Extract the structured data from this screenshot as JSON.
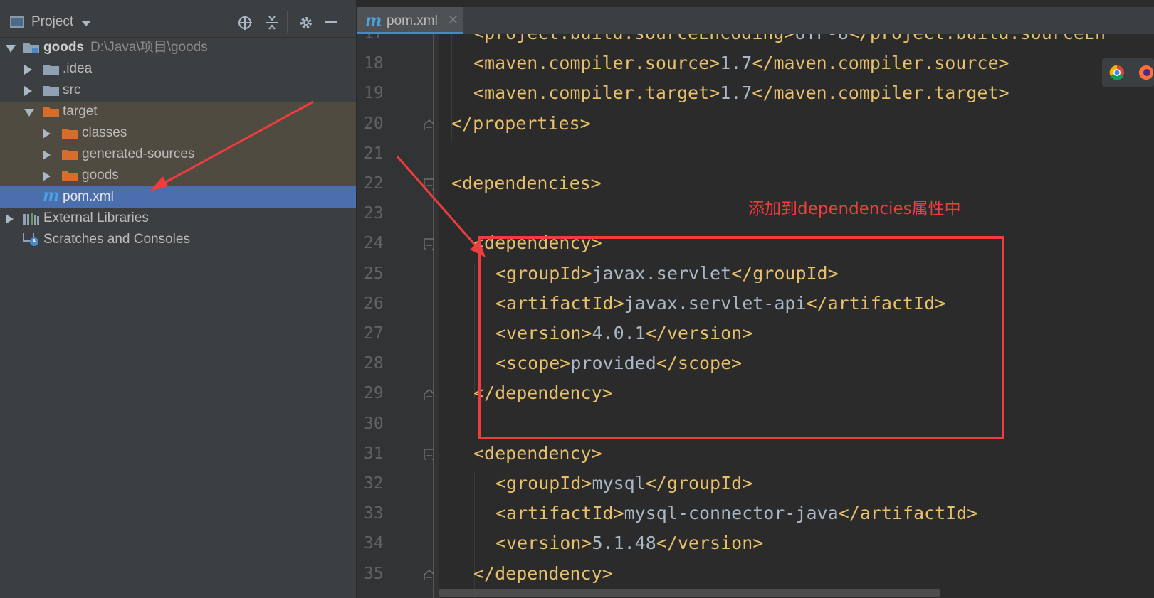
{
  "project_panel": {
    "title": "Project",
    "tree": [
      {
        "label": "goods",
        "path": "D:\\Java\\项目\\goods"
      },
      {
        "label": ".idea"
      },
      {
        "label": "src"
      },
      {
        "label": "target"
      },
      {
        "label": "classes"
      },
      {
        "label": "generated-sources"
      },
      {
        "label": "goods"
      },
      {
        "label": "pom.xml"
      },
      {
        "label": "External Libraries"
      },
      {
        "label": "Scratches and Consoles"
      }
    ]
  },
  "editor": {
    "tab": {
      "name": "pom.xml"
    },
    "line_numbers": [
      "17",
      "18",
      "19",
      "20",
      "21",
      "22",
      "23",
      "24",
      "25",
      "26",
      "27",
      "28",
      "29",
      "30",
      "31",
      "32",
      "33",
      "34",
      "35"
    ],
    "lines": [
      {
        "open": "<project.build.sourceEncoding>",
        "text": "UTF-8",
        "close": "</project.build.sourceEn"
      },
      {
        "open": "<maven.compiler.source>",
        "text": "1.7",
        "close": "</maven.compiler.source>"
      },
      {
        "open": "<maven.compiler.target>",
        "text": "1.7",
        "close": "</maven.compiler.target>"
      },
      {
        "open": "</properties>",
        "text": "",
        "close": ""
      },
      {
        "open": "",
        "text": "",
        "close": ""
      },
      {
        "open": "<dependencies>",
        "text": "",
        "close": ""
      },
      {
        "open": "",
        "text": "",
        "close": ""
      },
      {
        "open": "<dependency>",
        "text": "",
        "close": ""
      },
      {
        "open": "<groupId>",
        "text": "javax.servlet",
        "close": "</groupId>"
      },
      {
        "open": "<artifactId>",
        "text": "javax.servlet-api",
        "close": "</artifactId>"
      },
      {
        "open": "<version>",
        "text": "4.0.1",
        "close": "</version>"
      },
      {
        "open": "<scope>",
        "text": "provided",
        "close": "</scope>"
      },
      {
        "open": "</dependency>",
        "text": "",
        "close": ""
      },
      {
        "open": "",
        "text": "",
        "close": ""
      },
      {
        "open": "<dependency>",
        "text": "",
        "close": ""
      },
      {
        "open": "<groupId>",
        "text": "mysql",
        "close": "</groupId>"
      },
      {
        "open": "<artifactId>",
        "text": "mysql-connector-java",
        "close": "</artifactId>"
      },
      {
        "open": "<version>",
        "text": "5.1.48",
        "close": "</version>"
      },
      {
        "open": "</dependency>",
        "text": "",
        "close": ""
      }
    ]
  },
  "annotation": {
    "text": "添加到dependencies属性中"
  },
  "colors": {
    "tag": "#e8bf6a",
    "text": "#a9b7c6",
    "annotation": "#f03c3c",
    "selection": "#4b6eaf"
  }
}
